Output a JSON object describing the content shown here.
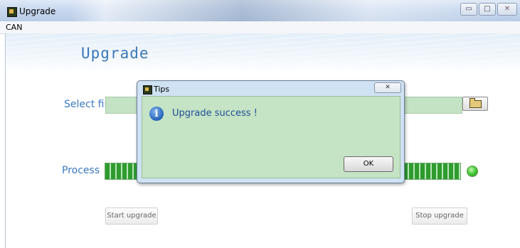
{
  "window": {
    "title": "Upgrade",
    "controls": {
      "minimize": "▭",
      "maximize": "□",
      "close": "✕"
    }
  },
  "menu": {
    "items": [
      "CAN"
    ]
  },
  "app": {
    "heading": "Upgrade",
    "select_file_label": "Select file",
    "file_path": "",
    "process_label": "Process",
    "start_button": "Start upgrade",
    "stop_button": "Stop upgrade",
    "status_led_color": "#4bcf3a"
  },
  "dialog": {
    "title": "Tips",
    "close_glyph": "✕",
    "info_glyph": "i",
    "message": "Upgrade success !",
    "ok_button": "OK"
  },
  "colors": {
    "accent_blue": "#3a79c4",
    "field_green": "#c4e3c4",
    "progress_green": "#2f9b2f"
  }
}
